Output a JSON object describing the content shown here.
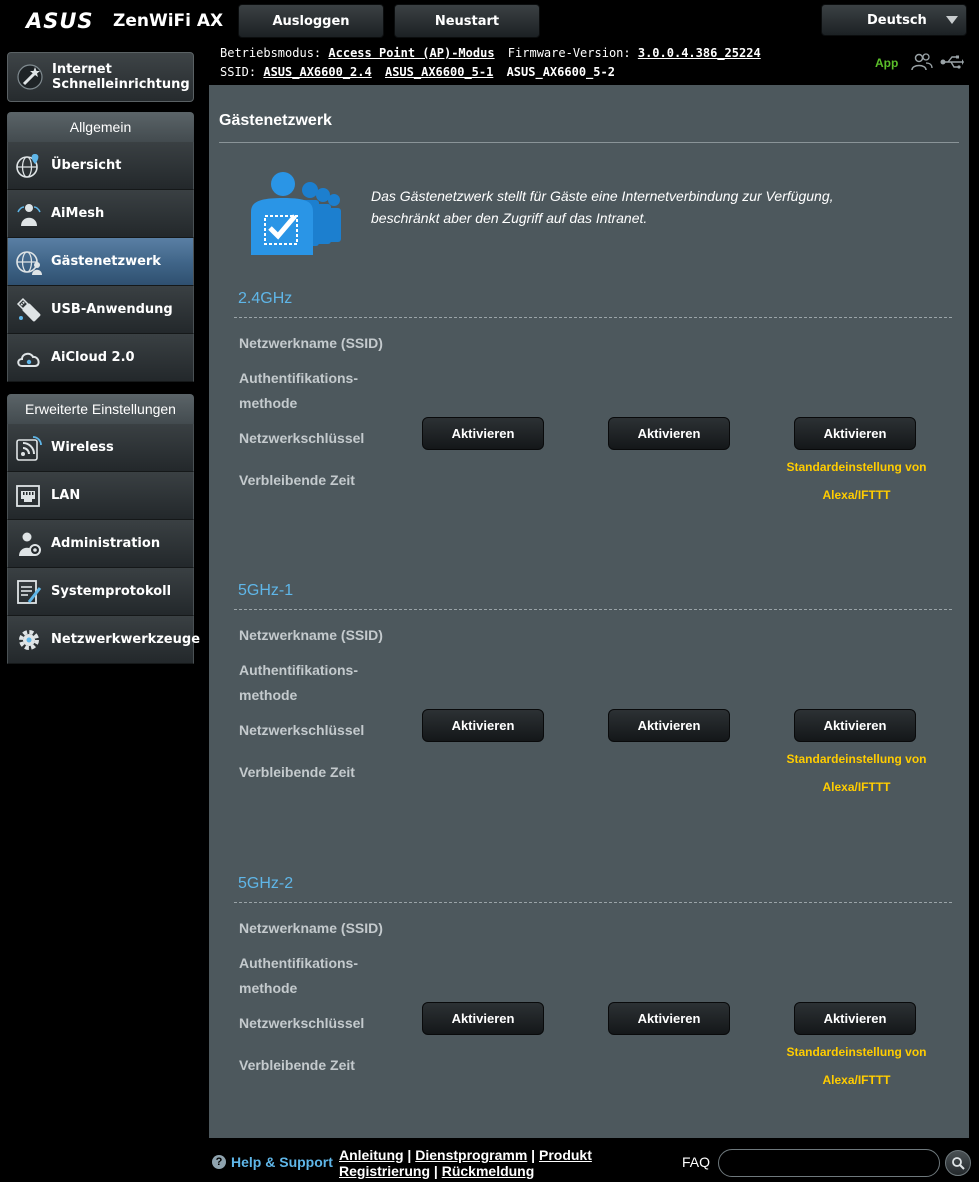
{
  "header": {
    "logo": "ASUS",
    "model": "ZenWiFi AX",
    "logout_label": "Ausloggen",
    "reboot_label": "Neustart",
    "language": "Deutsch"
  },
  "status": {
    "mode_label": "Betriebsmodus:",
    "mode_value": "Access Point (AP)-Modus",
    "firmware_label": "Firmware-Version:",
    "firmware_value": "3.0.0.4.386_25224",
    "ssid_label": "SSID:",
    "ssids": [
      "ASUS_AX6600_2.4",
      "ASUS_AX6600_5-1",
      "ASUS_AX6600_5-2"
    ],
    "app_label": "App",
    "icons": [
      "users-icon",
      "usb-icon"
    ]
  },
  "sidebar": {
    "quick_setup": {
      "line1": "Internet",
      "line2": "Schnelleinrichtung",
      "icon": "wand-icon"
    },
    "general_heading": "Allgemein",
    "general_items": [
      {
        "label": "Übersicht",
        "icon": "network-map-icon"
      },
      {
        "label": "AiMesh",
        "icon": "aimesh-icon"
      },
      {
        "label": "Gästenetzwerk",
        "icon": "guest-network-icon",
        "active": true
      },
      {
        "label": "USB-Anwendung",
        "icon": "usb-app-icon"
      },
      {
        "label": "AiCloud 2.0",
        "icon": "cloud-icon"
      }
    ],
    "advanced_heading": "Erweiterte Einstellungen",
    "advanced_items": [
      {
        "label": "Wireless",
        "icon": "wireless-icon"
      },
      {
        "label": "LAN",
        "icon": "lan-icon"
      },
      {
        "label": "Administration",
        "icon": "admin-icon"
      },
      {
        "label": "Systemprotokoll",
        "icon": "log-icon"
      },
      {
        "label": "Netzwerkwerkzeuge",
        "icon": "tools-icon"
      }
    ]
  },
  "main": {
    "title": "Gästenetzwerk",
    "intro_line1": "Das Gästenetzwerk stellt für Gäste eine Internetverbindung zur Verfügung,",
    "intro_line2": "beschränkt aber den Zugriff auf das Intranet.",
    "field_labels": {
      "ssid": "Netzwerkname (SSID)",
      "auth_line1": "Authentifikations-",
      "auth_line2": "methode",
      "key": "Netzwerkschlüssel",
      "time": "Verbleibende Zeit"
    },
    "activate_label": "Aktivieren",
    "alexa_line1": "Standardeinstellung von",
    "alexa_line2": "Alexa/IFTTT",
    "bands": [
      {
        "name": "2.4GHz"
      },
      {
        "name": "5GHz-1"
      },
      {
        "name": "5GHz-2"
      }
    ]
  },
  "footer": {
    "help_label": "Help & Support",
    "links": [
      "Anleitung",
      "Dienstprogramm",
      "Produkt",
      "Registrierung",
      "Rückmeldung"
    ],
    "faq_label": "FAQ",
    "search_value": "",
    "search_placeholder": ""
  }
}
